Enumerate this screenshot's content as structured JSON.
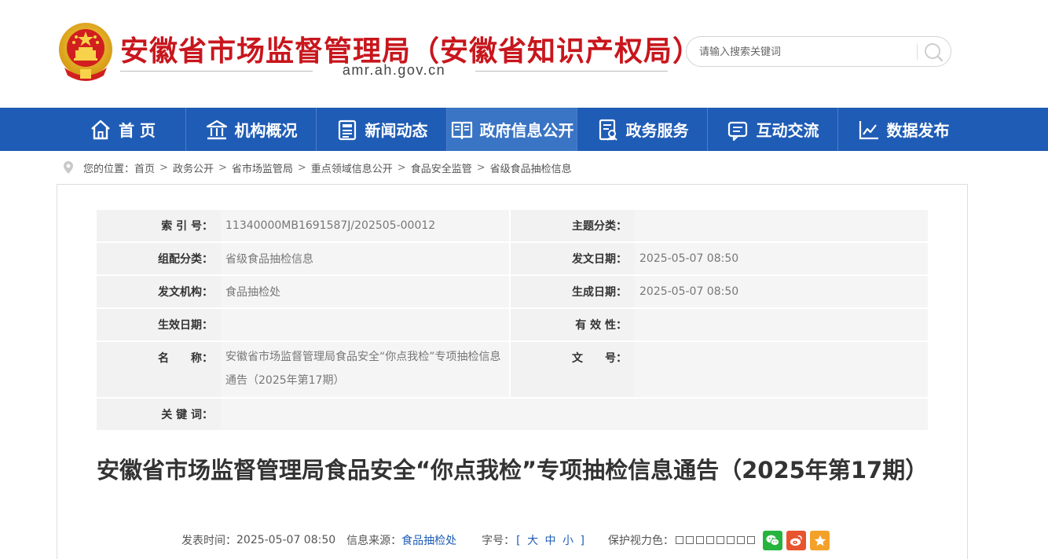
{
  "header": {
    "site_title": "安徽省市场监督管理局（安徽省知识产权局）",
    "domain": "amr.ah.gov.cn",
    "search": {
      "placeholder": "请输入搜索关键词"
    }
  },
  "nav": {
    "items": [
      {
        "label": "首 页",
        "icon": "home-icon"
      },
      {
        "label": "机构概况",
        "icon": "institution-icon"
      },
      {
        "label": "新闻动态",
        "icon": "news-icon"
      },
      {
        "label": "政府信息公开",
        "icon": "info-disclosure-icon"
      },
      {
        "label": "政务服务",
        "icon": "service-icon"
      },
      {
        "label": "互动交流",
        "icon": "chat-icon"
      },
      {
        "label": "数据发布",
        "icon": "chart-icon"
      }
    ],
    "active_index": 3
  },
  "breadcrumb": {
    "prefix": "您的位置：",
    "items": [
      "首页",
      "政务公开",
      "省市场监管局",
      "重点领域信息公开",
      "食品安全监管",
      "省级食品抽检信息"
    ],
    "separator": ">"
  },
  "meta": {
    "index_label": "索 引 号：",
    "index_value": "11340000MB1691587J/202505-00012",
    "topic_label": "主题分类：",
    "topic_value": "",
    "category_label": "组配分类：",
    "category_value": "省级食品抽检信息",
    "issue_date_label": "发文日期：",
    "issue_date_value": "2025-05-07 08:50",
    "issuer_label": "发文机构：",
    "issuer_value": "食品抽检处",
    "created_label": "生成日期：",
    "created_value": "2025-05-07 08:50",
    "effective_label": "生效日期：",
    "effective_value": "",
    "validity_label": "有 效 性：",
    "validity_value": "",
    "name_label": "名　　称：",
    "name_value": "安徽省市场监督管理局食品安全“你点我检”专项抽检信息通告（2025年第17期）",
    "doc_no_label": "文　　号：",
    "doc_no_value": "",
    "keywords_label": "关 键 词：",
    "keywords_value": ""
  },
  "article": {
    "title": "安徽省市场监督管理局食品安全“你点我检”专项抽检信息通告（2025年第17期）",
    "publish_label": "发表时间：",
    "publish_value": "2025-05-07 08:50",
    "source_label": "信息来源：",
    "source_value": "食品抽检处",
    "font_label": "字号：",
    "font_open": "[",
    "font_large": "大",
    "font_medium": "中",
    "font_small": "小",
    "font_close": "]",
    "eye_label": "保护视力色："
  },
  "colors": {
    "brand_red": "#c8161d",
    "nav_blue": "#1f5cb5",
    "nav_active": "#3a74c4",
    "wechat": "#27b43e",
    "weibo": "#e8542e",
    "favorite": "#f4a12a"
  }
}
